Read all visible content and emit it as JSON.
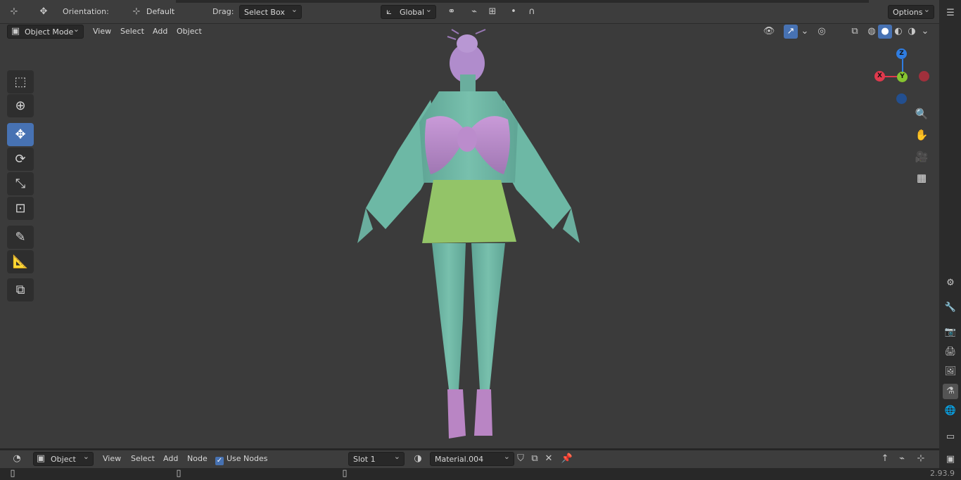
{
  "top_header": {
    "orientation_label": "Orientation:",
    "orientation_value": "Default",
    "drag_label": "Drag:",
    "drag_value": "Select Box",
    "transform_space": "Global",
    "options_label": "Options"
  },
  "viewport_header": {
    "mode": "Object Mode",
    "menus": [
      "View",
      "Select",
      "Add",
      "Object"
    ]
  },
  "toolbar": {
    "tools": [
      {
        "name": "select-box-tool",
        "glyph": "⬚"
      },
      {
        "name": "cursor-tool",
        "glyph": "⊕"
      },
      {
        "name": "move-tool",
        "glyph": "✥"
      },
      {
        "name": "rotate-tool",
        "glyph": "⟳"
      },
      {
        "name": "scale-tool",
        "glyph": "⤡"
      },
      {
        "name": "transform-tool",
        "glyph": "⊡"
      },
      {
        "name": "annotate-tool",
        "glyph": "✎"
      },
      {
        "name": "measure-tool",
        "glyph": "📐"
      },
      {
        "name": "add-cube-tool",
        "glyph": "⧉"
      }
    ]
  },
  "gizmo": {
    "x": "X",
    "y": "Y",
    "z": "Z"
  },
  "bottom_header": {
    "editor_type": "Object",
    "menus": [
      "View",
      "Select",
      "Add",
      "Node"
    ],
    "use_nodes_label": "Use Nodes",
    "slot_value": "Slot 1",
    "material_name": "Material.004"
  },
  "status": {
    "version": "2.93.9"
  },
  "colors": {
    "accent": "#4772b3",
    "axis_x": "#e0394d",
    "axis_y": "#86c430",
    "axis_z": "#2f7de1",
    "skin": "#6bb5a3",
    "bow": "#b888c8",
    "skirt": "#93c468"
  }
}
